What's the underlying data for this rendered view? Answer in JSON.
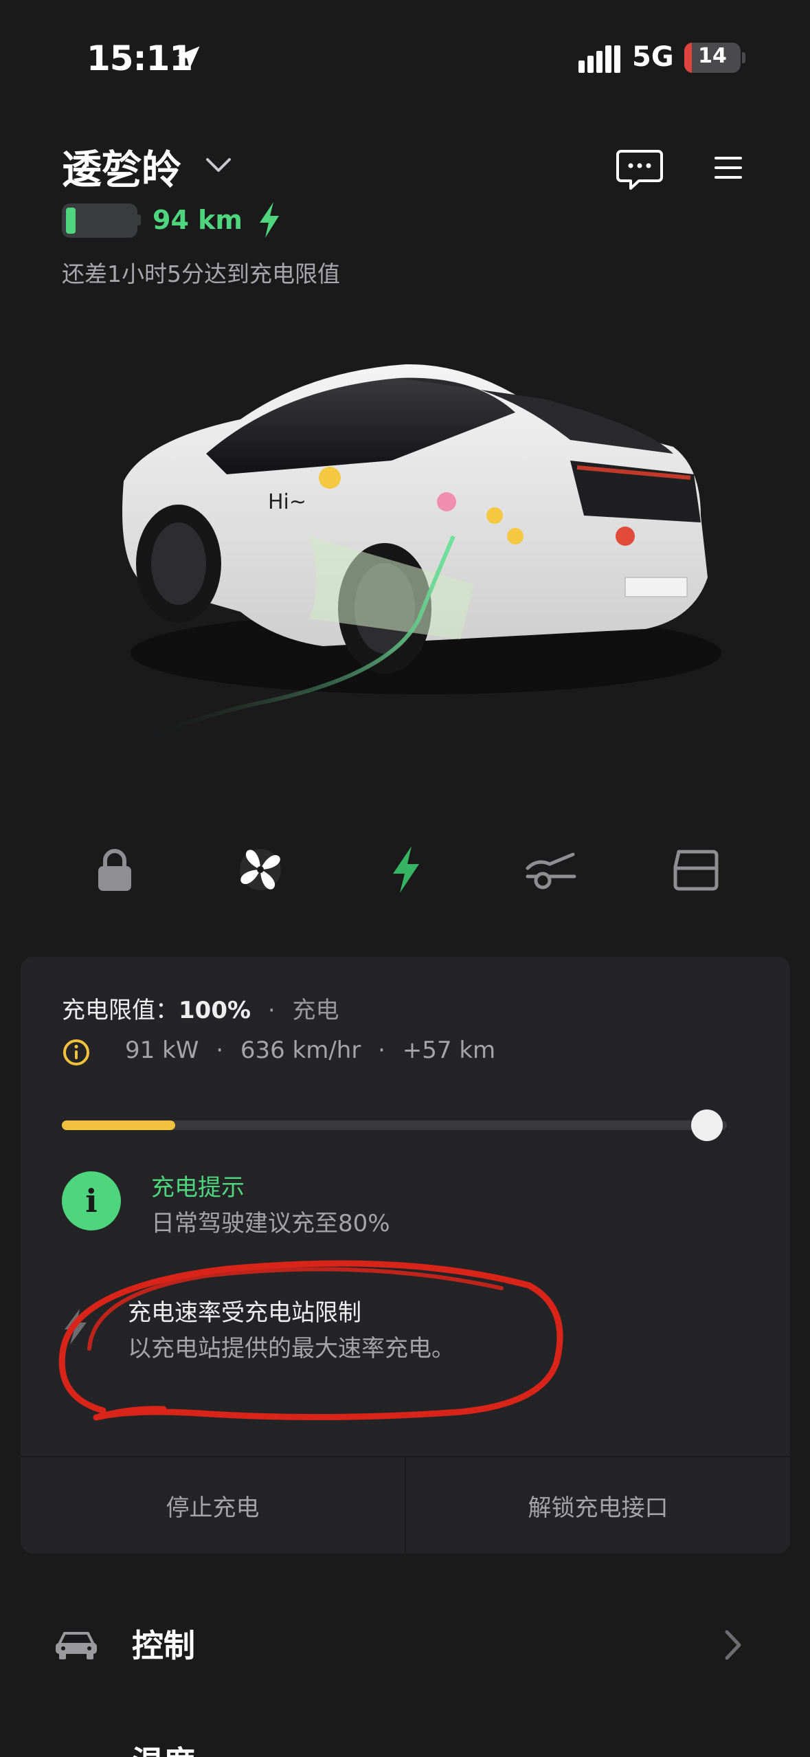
{
  "status_bar": {
    "time": "15:11",
    "network": "5G",
    "battery": "14",
    "battery_color": "#e0443e"
  },
  "header": {
    "vehicle_name": "逶乻皊",
    "range": "94 km",
    "charge_status": "还差1小时5分达到充电限值",
    "icons": [
      "chevron-down-icon",
      "chat-icon",
      "menu-icon",
      "battery-icon",
      "bolt-icon"
    ]
  },
  "quick_actions": [
    {
      "name": "lock",
      "icon": "lock-icon"
    },
    {
      "name": "climate",
      "icon": "fan-icon"
    },
    {
      "name": "charge",
      "icon": "bolt-icon"
    },
    {
      "name": "charge-port",
      "icon": "charge-port-icon"
    },
    {
      "name": "frunk",
      "icon": "frunk-icon"
    }
  ],
  "charging": {
    "limit_label": "充电限值：",
    "limit_value": "100%",
    "separator": "·",
    "state": "充电",
    "power": "91 kW",
    "rate": "636 km/hr",
    "added": "+57 km",
    "current_level_fraction": 0.17,
    "limit_fraction": 1.0,
    "tip_title": "充电提示",
    "tip_text": "日常驾驶建议充至80%",
    "tip_icon_glyph": "i",
    "notice_title": "充电速率受充电站限制",
    "notice_text": "以充电站提供的最大速率充电。",
    "stop_label": "停止充电",
    "unlock_label": "解锁充电接口"
  },
  "menu_rows": [
    {
      "label": "控制",
      "icon": "car-icon"
    },
    {
      "label": "温度",
      "icon": "thermometer-icon"
    }
  ],
  "colors": {
    "accent_green": "#4fd57d",
    "slider_yellow": "#f2c13d",
    "annotation_red": "#d9241a",
    "background": "#1a1a1b",
    "panel": "#242426"
  }
}
